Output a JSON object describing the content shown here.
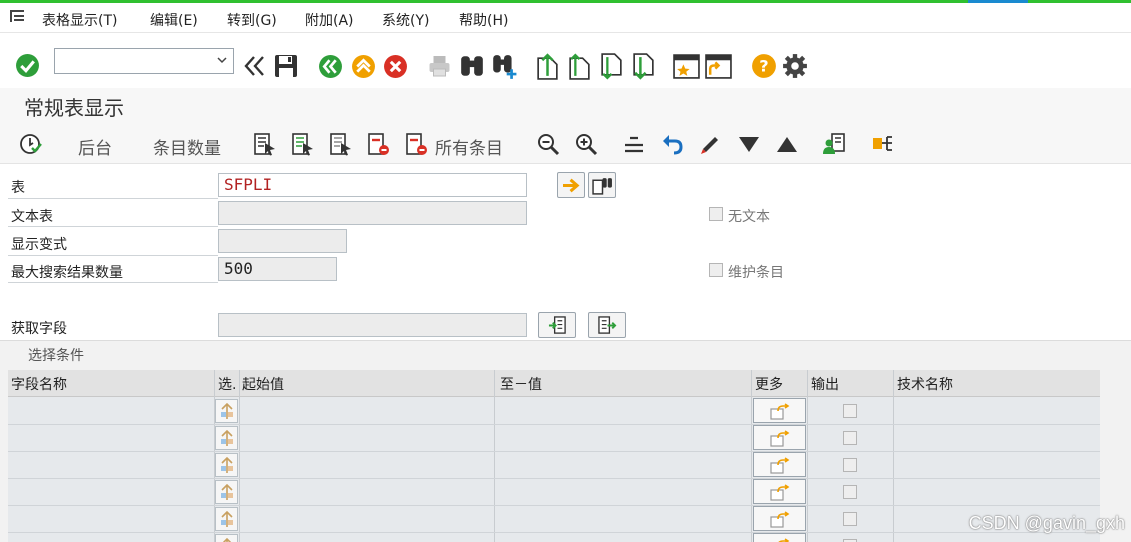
{
  "menubar": {
    "items": [
      {
        "label": "表格显示(T)"
      },
      {
        "label": "编辑(E)"
      },
      {
        "label": "转到(G)"
      },
      {
        "label": "附加(A)"
      },
      {
        "label": "系统(Y)"
      },
      {
        "label": "帮助(H)"
      }
    ]
  },
  "toolbar": {
    "command_field_value": ""
  },
  "title": "常规表显示",
  "app_toolbar": {
    "background_label": "后台",
    "entry_count_label": "条目数量",
    "all_entries_label": "所有条目"
  },
  "form": {
    "table_label": "表",
    "table_value": "SFPLI",
    "text_table_label": "文本表",
    "text_table_value": "",
    "display_variant_label": "显示变式",
    "display_variant_value": "",
    "max_hits_label": "最大搜索结果数量",
    "max_hits_value": "500",
    "get_fields_label": "获取字段",
    "get_fields_value": "",
    "no_text_label": "无文本",
    "no_text_checked": false,
    "maintain_entries_label": "维护条目",
    "maintain_entries_checked": false
  },
  "selection": {
    "title": "选择条件",
    "columns": {
      "field_name": "字段名称",
      "select": "选.",
      "from_value": "起始值",
      "to_value": "至－值",
      "more": "更多",
      "output": "输出",
      "tech_name": "技术名称"
    },
    "rows": [
      {
        "field_name": "",
        "from": "",
        "to": "",
        "output": false,
        "tech_name": ""
      },
      {
        "field_name": "",
        "from": "",
        "to": "",
        "output": false,
        "tech_name": ""
      },
      {
        "field_name": "",
        "from": "",
        "to": "",
        "output": false,
        "tech_name": ""
      },
      {
        "field_name": "",
        "from": "",
        "to": "",
        "output": false,
        "tech_name": ""
      },
      {
        "field_name": "",
        "from": "",
        "to": "",
        "output": false,
        "tech_name": ""
      },
      {
        "field_name": "",
        "from": "",
        "to": "",
        "output": false,
        "tech_name": ""
      }
    ]
  },
  "watermark": "CSDN @gavin_gxh",
  "colors": {
    "accent_green": "#30c030",
    "value_red": "#b22222",
    "icon_blue": "#1a6fc0",
    "icon_orange": "#f0a000",
    "icon_red": "#d93025"
  }
}
